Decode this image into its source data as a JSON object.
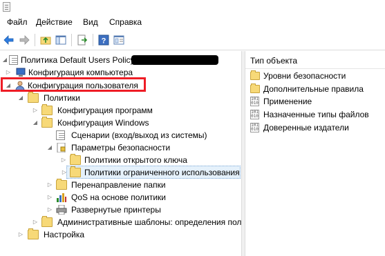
{
  "menu": {
    "file": "Файл",
    "action": "Действие",
    "view": "Вид",
    "help": "Справка"
  },
  "toolbar": {
    "back_icon": "arrow-left-icon",
    "forward_icon": "arrow-right-icon",
    "up_icon": "folder-up-icon",
    "show_tree_icon": "console-tree-icon",
    "export_icon": "export-list-icon",
    "help_icon": "help-icon",
    "properties_icon": "properties-icon"
  },
  "tree": {
    "root": "Политика Default Users Policy [",
    "computer_config": "Конфигурация компьютера",
    "user_config": "Конфигурация пользователя",
    "policies": "Политики",
    "software_settings": "Конфигурация программ",
    "windows_settings": "Конфигурация Windows",
    "scripts": "Сценарии (вход/выход из системы)",
    "security_settings": "Параметры безопасности",
    "public_key": "Политики открытого ключа",
    "restricted_use": "Политики ограниченного использования",
    "folder_redirection": "Перенаправление папки",
    "qos": "QoS на основе политики",
    "printers": "Развернутые принтеры",
    "admin_templates": "Административные шаблоны: определения пол",
    "preferences": "Настройка"
  },
  "right": {
    "header": "Тип объекта",
    "items": [
      {
        "label": "Уровни безопасности",
        "icon": "folder-icon"
      },
      {
        "label": "Дополнительные правила",
        "icon": "folder-icon"
      },
      {
        "label": "Применение",
        "icon": "binary-file-icon"
      },
      {
        "label": "Назначенные типы файлов",
        "icon": "binary-file-icon"
      },
      {
        "label": "Доверенные издатели",
        "icon": "binary-file-icon"
      }
    ]
  },
  "colors": {
    "highlight_border": "#ee1c25",
    "selection_bg": "#e5f1fb",
    "folder": "#f7d978"
  }
}
